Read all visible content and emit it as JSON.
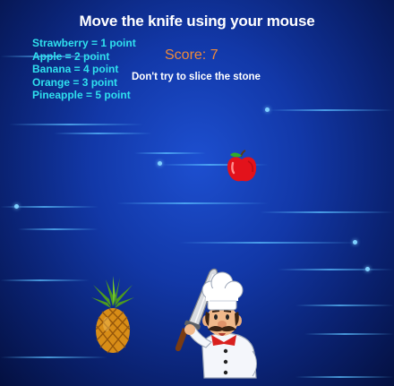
{
  "game": {
    "instructions": "Move the knife using your mouse",
    "points": [
      {
        "fruit": "Strawberry",
        "text": "Strawberry = 1 point"
      },
      {
        "fruit": "Apple",
        "text": "Apple = 2 point"
      },
      {
        "fruit": "Banana",
        "text": "Banana = 4 point"
      },
      {
        "fruit": "Orange",
        "text": "Orange = 3 point"
      },
      {
        "fruit": "Pineapple",
        "text": "Pineapple = 5 point"
      }
    ],
    "score_label": "Score: 7",
    "warning": "Don't try to slice the stone"
  },
  "colors": {
    "legend_text": "#2fe0ee",
    "score_text": "#ee8a3a",
    "title_text": "#ffffff",
    "background": "#1238a8"
  },
  "sprites": [
    "apple-icon",
    "pineapple-icon",
    "chef-with-knife"
  ]
}
